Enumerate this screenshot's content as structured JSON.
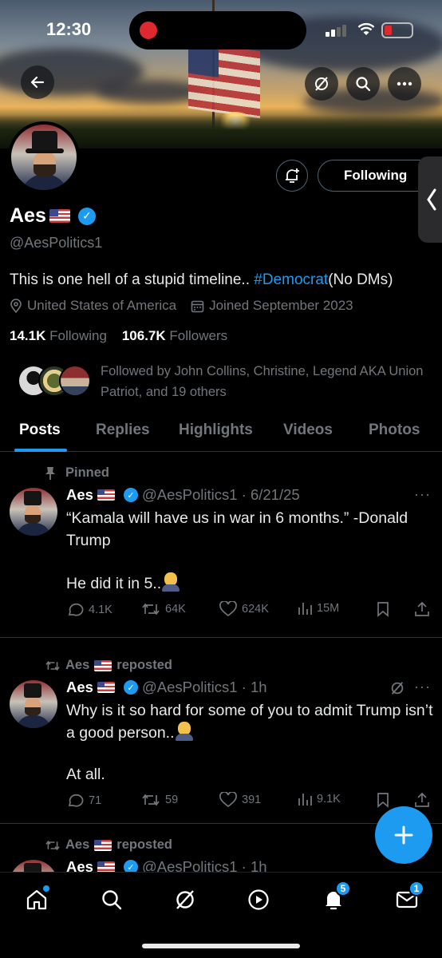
{
  "status_bar": {
    "time": "12:30"
  },
  "profile": {
    "name": "Aes",
    "handle": "@AesPolitics1",
    "bio_text": "This is one hell of a stupid timeline.. ",
    "bio_hashtag": "#Democrat",
    "bio_suffix": "(No DMs)",
    "location": "United States of America",
    "joined": "Joined September 2023",
    "following_count": "14.1K",
    "following_label": "Following",
    "followers_count": "106.7K",
    "followers_label": "Followers",
    "followed_by": "Followed by John Collins, Christine, Legend AKA Union Patriot, and 19 others",
    "follow_button": "Following"
  },
  "tabs": [
    {
      "label": "Posts",
      "active": true
    },
    {
      "label": "Replies"
    },
    {
      "label": "Highlights"
    },
    {
      "label": "Videos"
    },
    {
      "label": "Photos"
    }
  ],
  "posts": [
    {
      "context": "Pinned",
      "author": "Aes",
      "handle_time": "@AesPolitics1 · 6/21/25",
      "text1": "“Kamala will have us in war in 6 months.” -Donald Trump",
      "text2": "He did it in 5..",
      "replies": "4.1K",
      "reposts": "64K",
      "likes": "624K",
      "views": "15M"
    },
    {
      "context": "Aes",
      "context_suffix": "reposted",
      "author": "Aes",
      "handle_time": "@AesPolitics1 · 1h",
      "text1": "Why is it so hard for some of you to admit Trump isn’t a good person..",
      "text2": "At all.",
      "replies": "71",
      "reposts": "59",
      "likes": "391",
      "views": "9.1K"
    },
    {
      "context": "Aes",
      "context_suffix": "reposted",
      "author": "Aes",
      "handle_time": "@AesPolitics1 · 1h"
    }
  ],
  "bottom_nav": {
    "notifications_badge": "5",
    "messages_badge": "1"
  },
  "icons": [
    "back-icon",
    "grok-icon",
    "search-icon",
    "more-icon",
    "bell-plus-icon",
    "location-icon",
    "calendar-icon",
    "pin-icon",
    "repost-icon",
    "reply-icon",
    "like-icon",
    "views-icon",
    "bookmark-icon",
    "share-icon",
    "home-icon",
    "play-icon",
    "bell-icon",
    "mail-icon",
    "compose-icon"
  ],
  "colors": {
    "accent": "#1d9bf0",
    "background": "#000000",
    "muted": "#71767b"
  }
}
